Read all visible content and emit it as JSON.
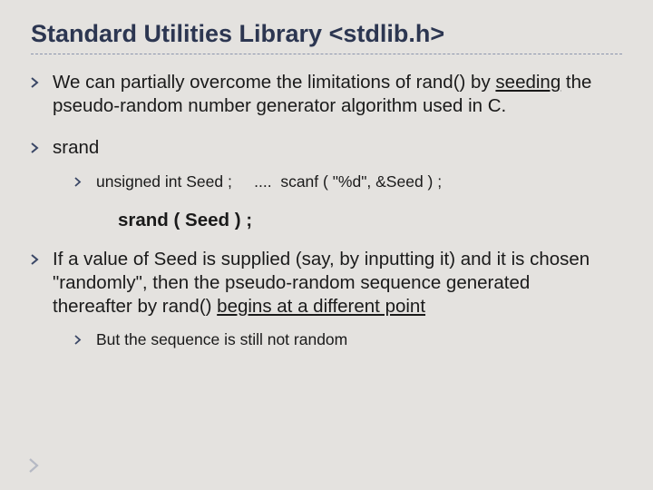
{
  "title": "Standard Utilities Library <stdlib.h>",
  "bullets": {
    "b1": {
      "pre": "We can partially overcome the limitations of rand() by ",
      "seeding": "seeding",
      "post": " the pseudo-random number generator algorithm used in C."
    },
    "b2": {
      "label": "srand"
    },
    "b2a": {
      "text": "unsigned int Seed ;     ....  scanf ( \"%d\", &Seed ) ;"
    },
    "codeLine": "srand ( Seed ) ;",
    "b3": {
      "pre": "If a value of Seed is supplied (say, by inputting it) and it is chosen \"randomly\", then the pseudo-random sequence generated thereafter by rand() ",
      "begins": "begins at a different point"
    },
    "b3a": {
      "text": "But the sequence is still not random"
    }
  }
}
